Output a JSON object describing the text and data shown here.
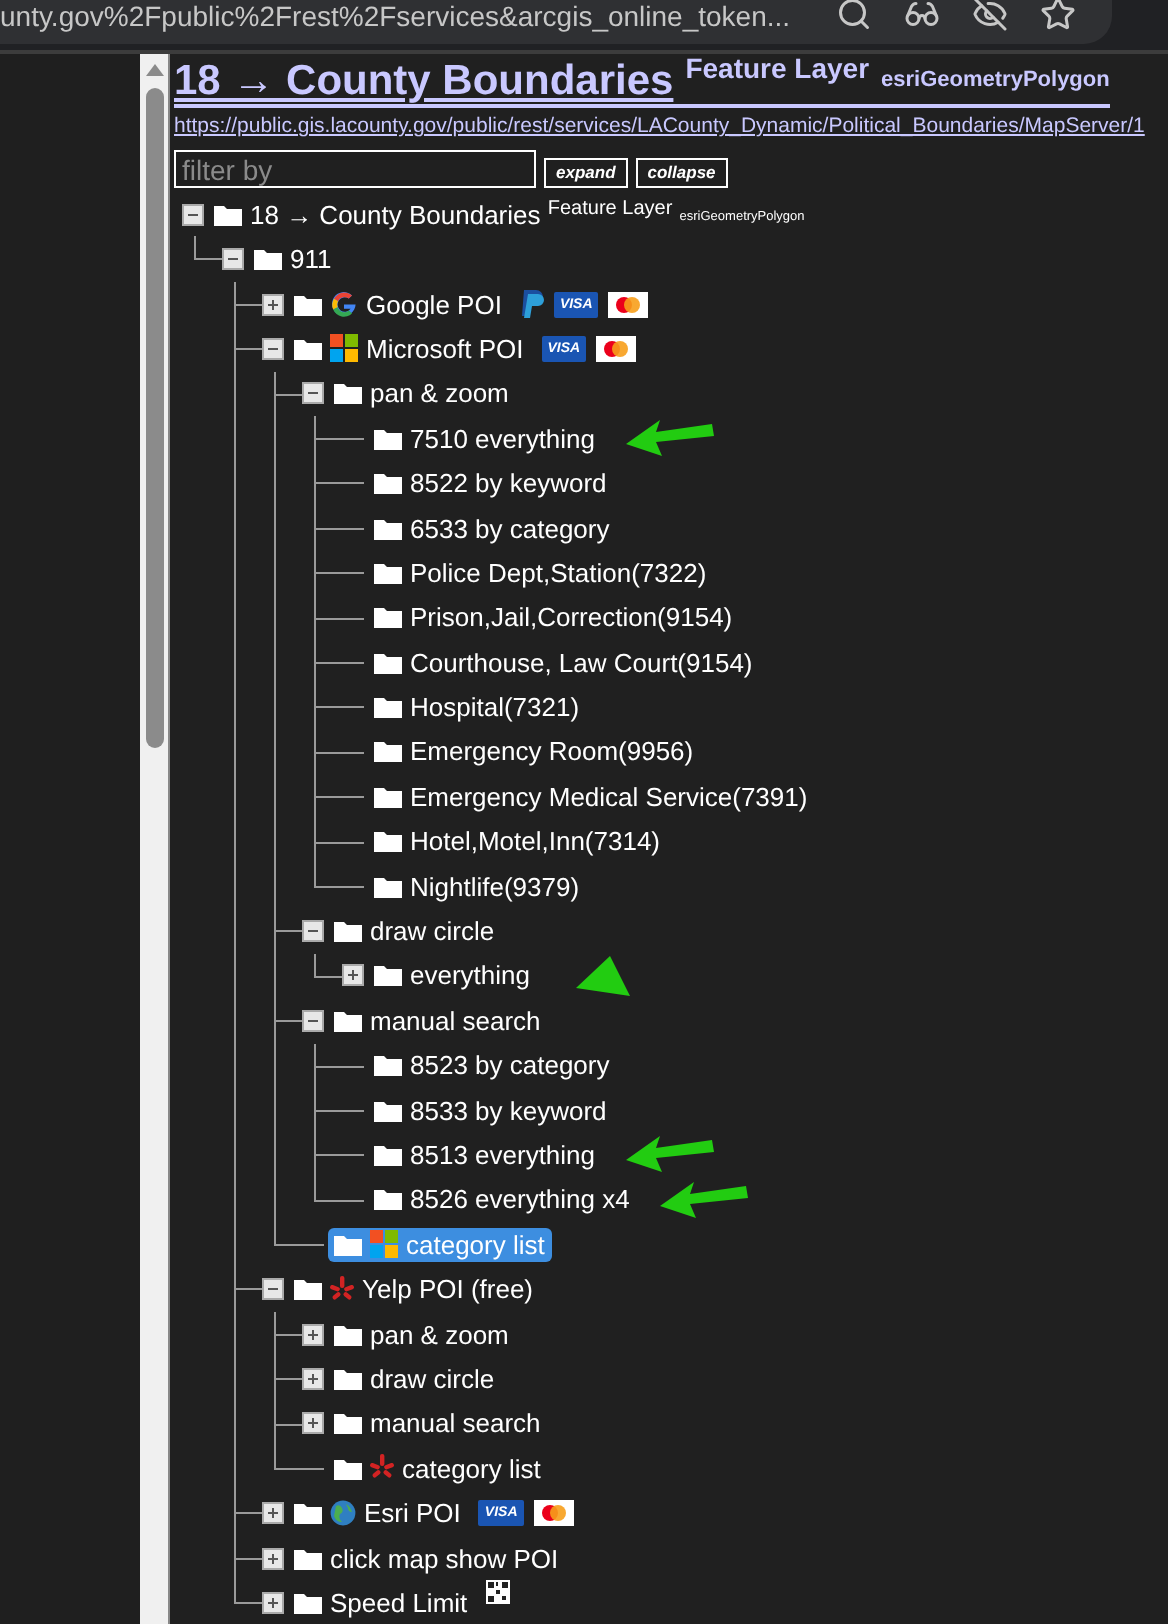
{
  "browser": {
    "address": "unty.gov%2Fpublic%2Frest%2Fservices&arcgis_online_token..."
  },
  "header": {
    "title": "18 → County Boundaries",
    "type_label": "Feature Layer",
    "geometry": "esriGeometryPolygon",
    "url": "https://public.gis.lacounty.gov/public/rest/services/LACounty_Dynamic/Political_Boundaries/MapServer/1"
  },
  "filter": {
    "placeholder": "filter by",
    "buttons": [
      "expand",
      "collapse"
    ]
  },
  "tree": {
    "label": "18 → County Boundaries",
    "type_label": "Feature Layer",
    "geometry": "esriGeometryPolygon",
    "expanded": true,
    "selected": false,
    "children": [
      {
        "label": "911",
        "expanded": true,
        "selected": false,
        "children": [
          {
            "label": "Google POI",
            "logo": {
              "kind": "google"
            },
            "expanded": false,
            "selected": false,
            "badges": [
              {
                "kind": "paypal"
              },
              {
                "kind": "visa",
                "text": "VISA"
              },
              {
                "kind": "mastercard"
              }
            ]
          },
          {
            "label": "Microsoft POI",
            "logo": {
              "kind": "microsoft"
            },
            "expanded": true,
            "selected": false,
            "badges": [
              {
                "kind": "visa",
                "text": "VISA"
              },
              {
                "kind": "mastercard"
              }
            ],
            "children": [
              {
                "label": "pan & zoom",
                "expanded": true,
                "selected": false,
                "children": [
                  {
                    "label": "7510 everything",
                    "selected": false,
                    "marker": {
                      "kind": "arrow"
                    }
                  },
                  {
                    "label": "8522 by keyword",
                    "selected": false
                  },
                  {
                    "label": "6533 by category",
                    "selected": false
                  },
                  {
                    "label": "Police Dept,Station(7322)",
                    "selected": false
                  },
                  {
                    "label": "Prison,Jail,Correction(9154)",
                    "selected": false
                  },
                  {
                    "label": "Courthouse, Law Court(9154)",
                    "selected": false
                  },
                  {
                    "label": "Hospital(7321)",
                    "selected": false
                  },
                  {
                    "label": "Emergency Room(9956)",
                    "selected": false
                  },
                  {
                    "label": "Emergency Medical Service(7391)",
                    "selected": false
                  },
                  {
                    "label": "Hotel,Motel,Inn(7314)",
                    "selected": false
                  },
                  {
                    "label": "Nightlife(9379)",
                    "selected": false
                  }
                ]
              },
              {
                "label": "draw circle",
                "expanded": true,
                "selected": false,
                "children": [
                  {
                    "label": "everything",
                    "expanded": false,
                    "selected": false,
                    "marker": {
                      "kind": "triangle"
                    }
                  }
                ]
              },
              {
                "label": "manual search",
                "expanded": true,
                "selected": false,
                "children": [
                  {
                    "label": "8523 by category",
                    "selected": false
                  },
                  {
                    "label": "8533 by keyword",
                    "selected": false
                  },
                  {
                    "label": "8513 everything",
                    "selected": false,
                    "marker": {
                      "kind": "arrow"
                    }
                  },
                  {
                    "label": "8526 everything x4",
                    "selected": false,
                    "marker": {
                      "kind": "arrow"
                    }
                  }
                ]
              },
              {
                "label": "category list",
                "logo": {
                  "kind": "microsoft"
                },
                "selected": true
              }
            ]
          },
          {
            "label": "Yelp POI (free)",
            "logo": {
              "kind": "yelp"
            },
            "expanded": true,
            "selected": false,
            "children": [
              {
                "label": "pan & zoom",
                "expanded": false,
                "selected": false
              },
              {
                "label": "draw circle",
                "expanded": false,
                "selected": false
              },
              {
                "label": "manual search",
                "expanded": false,
                "selected": false
              },
              {
                "label": "category list",
                "logo": {
                  "kind": "yelp"
                },
                "selected": false
              }
            ]
          },
          {
            "label": "Esri POI",
            "logo": {
              "kind": "globe"
            },
            "expanded": false,
            "selected": false,
            "badges": [
              {
                "kind": "visa",
                "text": "VISA"
              },
              {
                "kind": "mastercard"
              }
            ]
          },
          {
            "label": "click map show POI",
            "expanded": false,
            "selected": false
          },
          {
            "label": "Speed Limit",
            "expanded": false,
            "selected": false,
            "badges": [
              {
                "kind": "qr"
              }
            ]
          }
        ]
      }
    ]
  }
}
